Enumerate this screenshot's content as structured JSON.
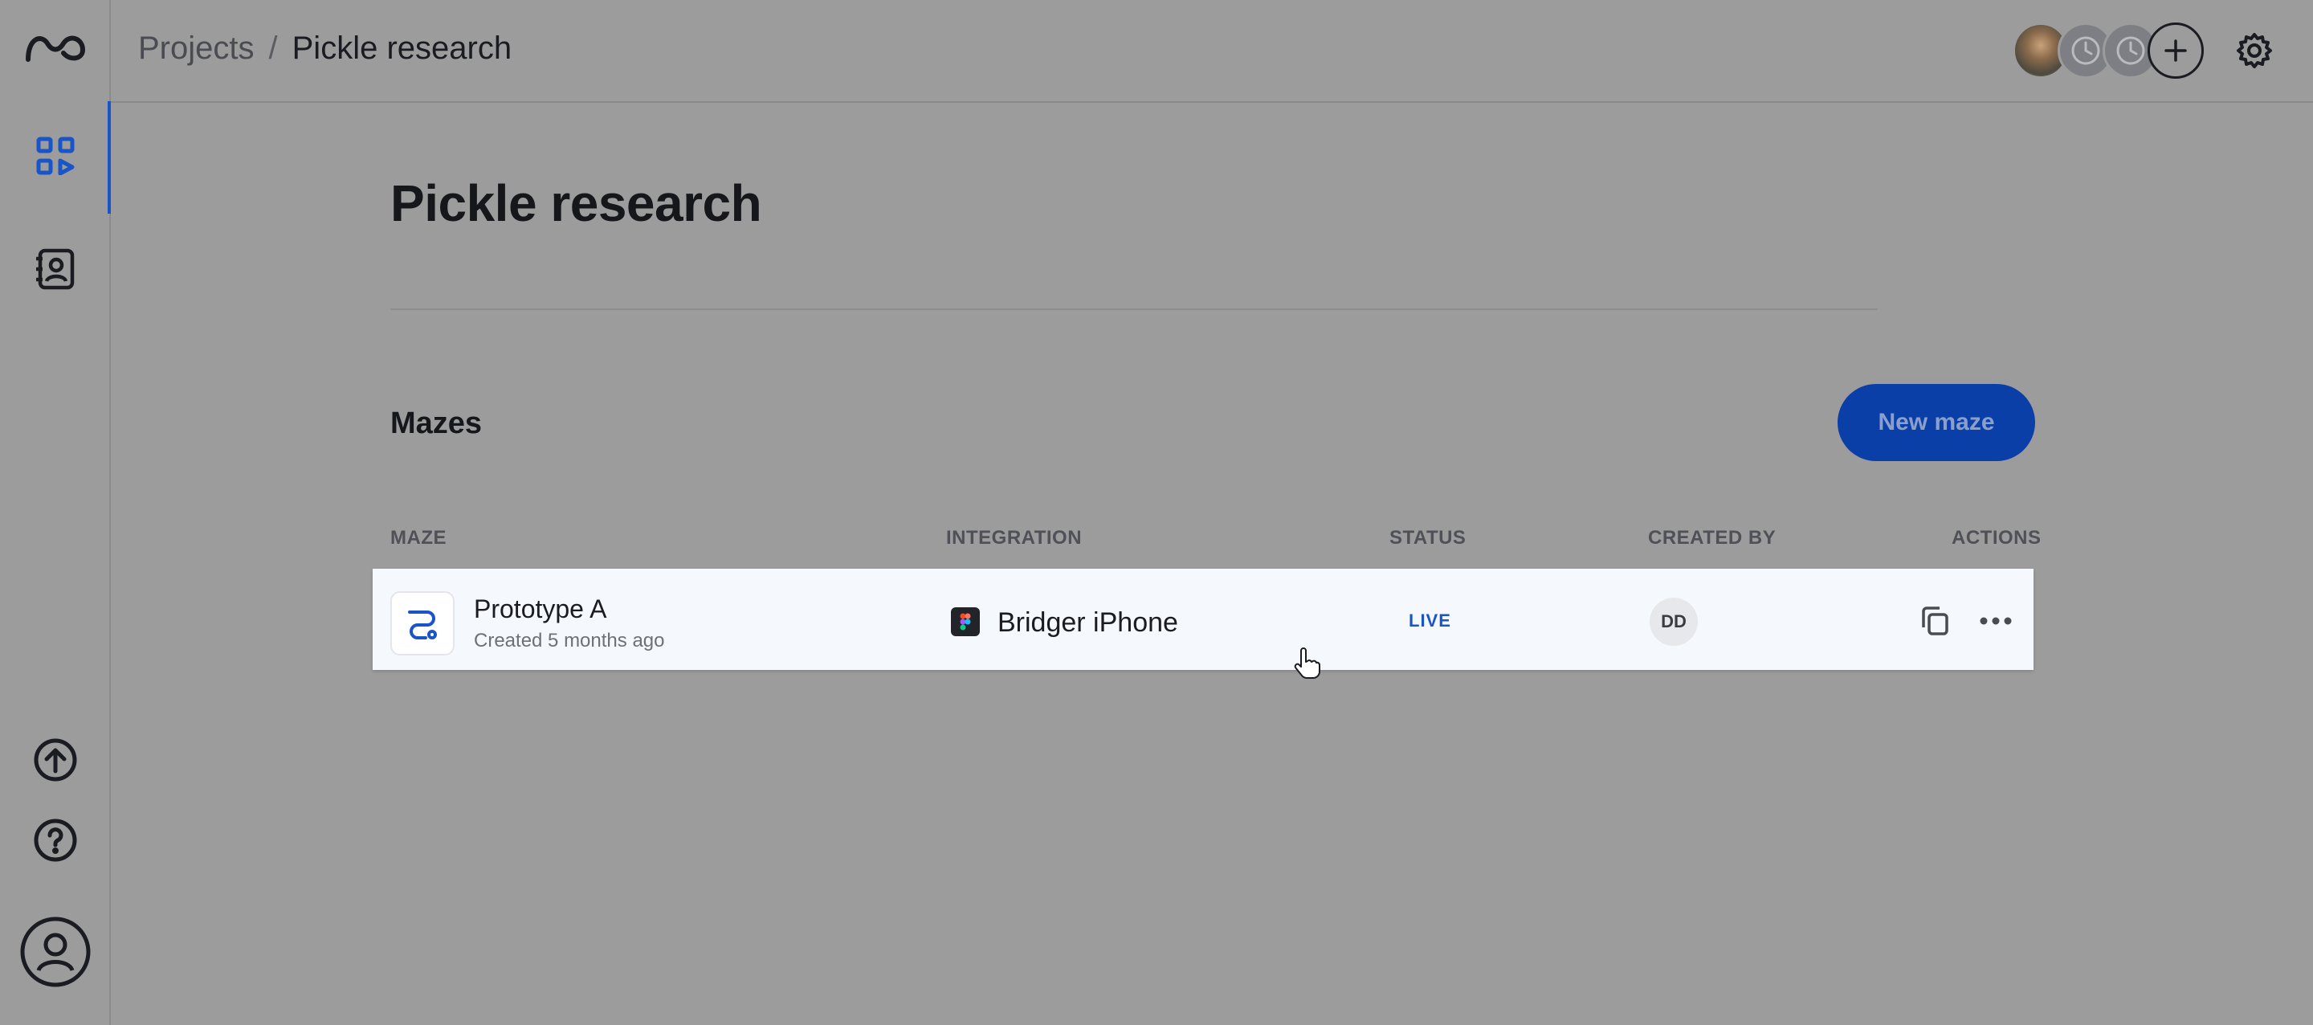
{
  "breadcrumb": {
    "parent": "Projects",
    "separator": "/",
    "current": "Pickle research"
  },
  "page": {
    "title": "Pickle research"
  },
  "section": {
    "title": "Mazes",
    "new_button": "New maze"
  },
  "table": {
    "columns": [
      "MAZE",
      "INTEGRATION",
      "STATUS",
      "CREATED BY",
      "ACTIONS"
    ],
    "rows": [
      {
        "name": "Prototype A",
        "created": "Created 5 months ago",
        "integration": "Bridger iPhone",
        "integration_icon": "figma-icon",
        "status": "LIVE",
        "created_by": "DD"
      }
    ]
  },
  "colors": {
    "accent": "#1a55c8",
    "button": "#0b3fa8",
    "overlay_bg": "#9c9c9c"
  }
}
